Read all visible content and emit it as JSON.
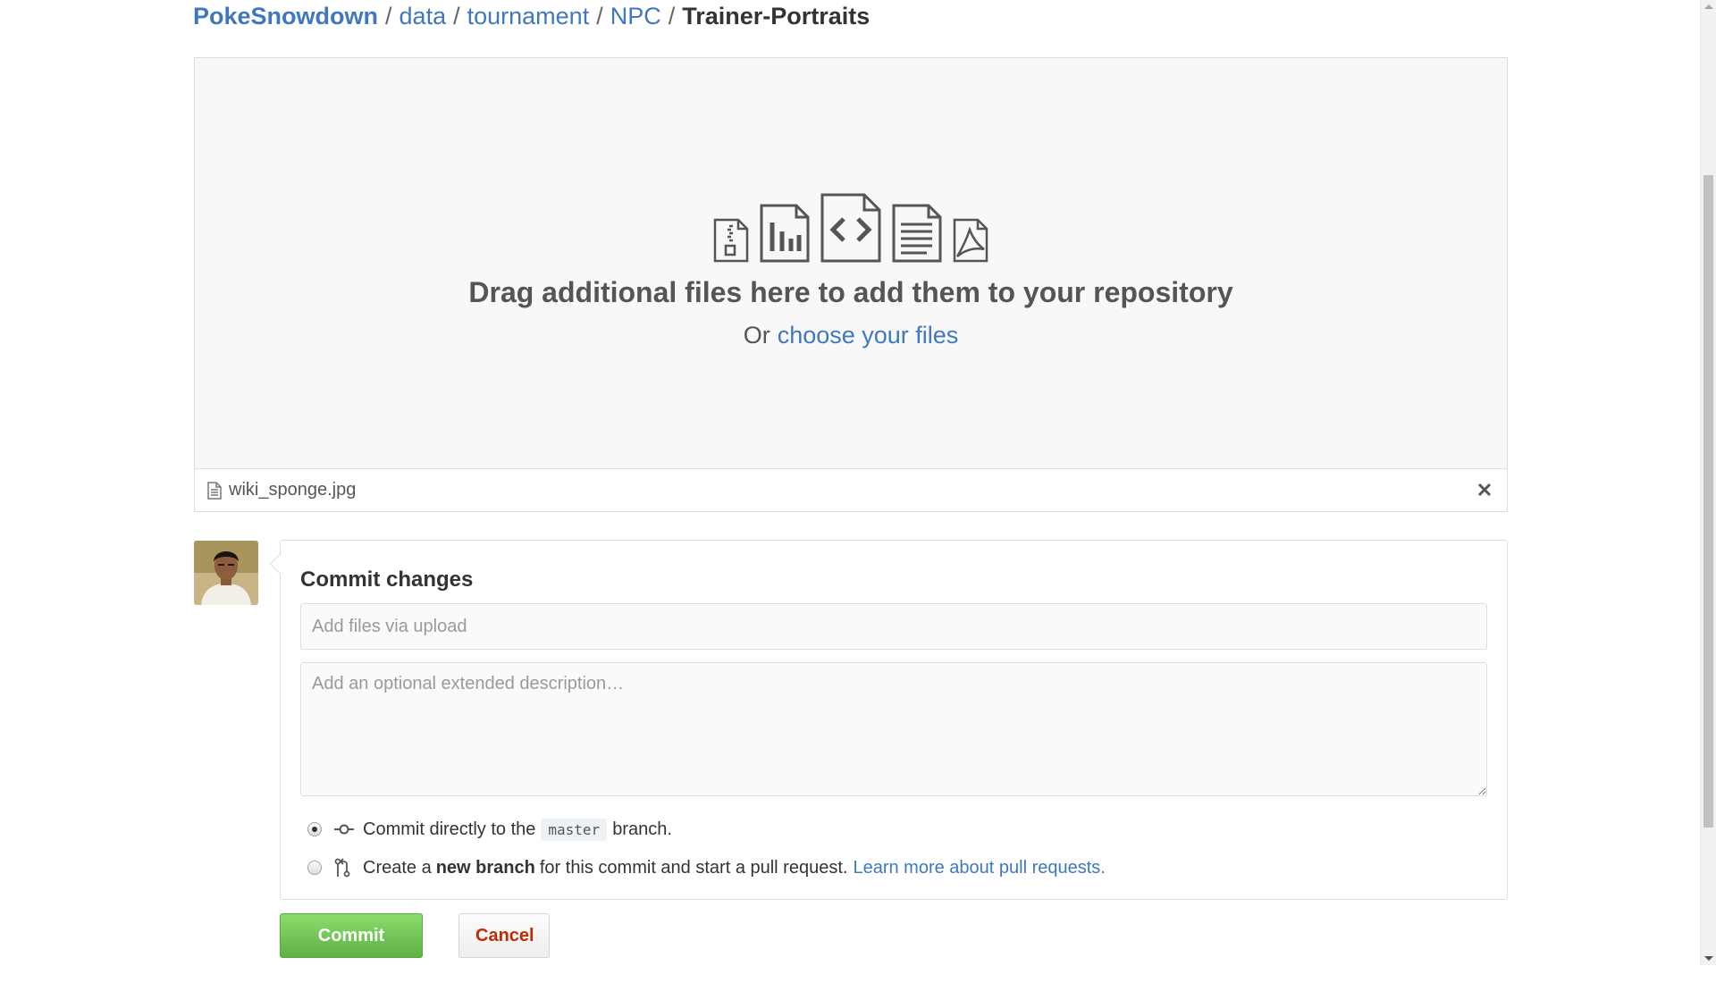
{
  "breadcrumb": {
    "repo": "PokeSnowdown",
    "segments": [
      "data",
      "tournament",
      "NPC"
    ],
    "current": "Trainer-Portraits",
    "separator": "/"
  },
  "dropzone": {
    "icons": [
      "zip-file-icon",
      "chart-file-icon",
      "code-file-icon",
      "text-file-icon",
      "pdf-file-icon"
    ],
    "title": "Drag additional files here to add them to your repository",
    "or_text": "Or",
    "choose_link": "choose your files"
  },
  "uploaded_file": {
    "name": "wiki_sponge.jpg"
  },
  "commit": {
    "title": "Commit changes",
    "summary_placeholder": "Add files via upload",
    "description_placeholder": "Add an optional extended description…",
    "option_direct": {
      "prefix": "Commit directly to the",
      "branch": "master",
      "suffix": "branch.",
      "selected": true
    },
    "option_new_branch": {
      "prefix": "Create a",
      "bold": "new branch",
      "suffix": "for this commit and start a pull request.",
      "link": "Learn more about pull requests.",
      "selected": false
    }
  },
  "buttons": {
    "commit": "Commit changes",
    "cancel": "Cancel"
  },
  "colors": {
    "link": "#4078c0",
    "commit_button": "#60b044",
    "cancel_text": "#bd2c00"
  }
}
